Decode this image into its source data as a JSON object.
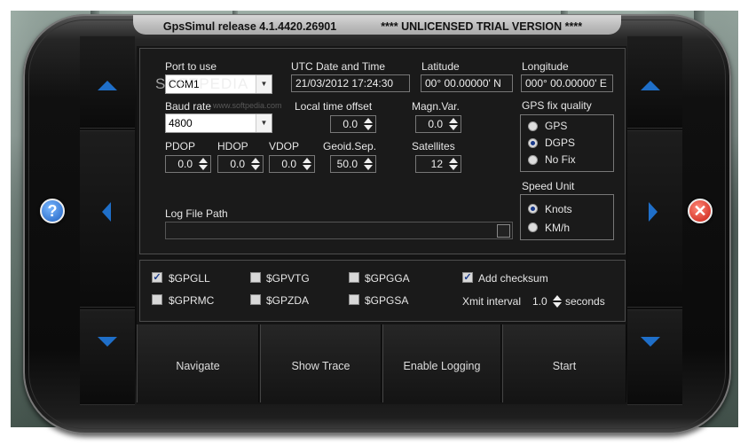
{
  "titlebar": {
    "app": "GpsSimul release 4.1.4420.26901",
    "license": "**** UNLICENSED TRIAL VERSION ****"
  },
  "watermark": "SOFTPEDIA",
  "watermark_sub": "www.softpedia.com",
  "fields": {
    "port_label": "Port to use",
    "port_value": "COM1",
    "utc_label": "UTC Date and Time",
    "utc_value": "21/03/2012 17:24:30",
    "lat_label": "Latitude",
    "lat_value": "00° 00.00000' N",
    "lon_label": "Longitude",
    "lon_value": "000° 00.00000' E",
    "baud_label": "Baud rate",
    "baud_value": "4800",
    "lto_label": "Local time offset",
    "lto_value": "0.0",
    "magvar_label": "Magn.Var.",
    "magvar_value": "0.0",
    "pdop_label": "PDOP",
    "pdop_value": "0.0",
    "hdop_label": "HDOP",
    "hdop_value": "0.0",
    "vdop_label": "VDOP",
    "vdop_value": "0.0",
    "geoid_label": "Geoid.Sep.",
    "geoid_value": "50.0",
    "sat_label": "Satellites",
    "sat_value": "12",
    "log_label": "Log File Path",
    "log_value": ""
  },
  "gps_fix": {
    "title": "GPS fix quality",
    "options": [
      "GPS",
      "DGPS",
      "No Fix"
    ],
    "selected": "DGPS"
  },
  "speed_unit": {
    "title": "Speed Unit",
    "options": [
      "Knots",
      "KM/h"
    ],
    "selected": "Knots"
  },
  "sentences": {
    "gpgll": {
      "label": "$GPGLL",
      "checked": true
    },
    "gpvtg": {
      "label": "$GPVTG",
      "checked": false
    },
    "gpgga": {
      "label": "$GPGGA",
      "checked": false
    },
    "gprmc": {
      "label": "$GPRMC",
      "checked": false
    },
    "gpzda": {
      "label": "$GPZDA",
      "checked": false
    },
    "gpgsa": {
      "label": "$GPGSA",
      "checked": false
    }
  },
  "checksum": {
    "label": "Add checksum",
    "checked": true
  },
  "xmit": {
    "label": "Xmit interval",
    "value": "1.0",
    "unit": "seconds"
  },
  "nav": {
    "navigate": "Navigate",
    "show_trace": "Show Trace",
    "enable_logging": "Enable Logging",
    "start": "Start"
  },
  "icons": {
    "help": "?",
    "close": "✕"
  },
  "colors": {
    "accent": "#1f6fc9",
    "close": "#c8190e"
  }
}
